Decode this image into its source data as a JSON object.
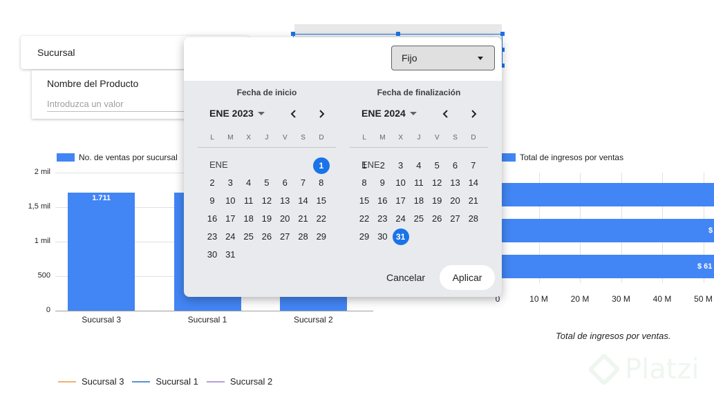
{
  "filters": {
    "sucursal_label": "Sucursal",
    "producto_label": "Nombre del Producto",
    "producto_placeholder": "Introduzca un valor"
  },
  "date_picker": {
    "mode_value": "Fijo",
    "start": {
      "title": "Fecha de inicio",
      "month_label": "ENE 2023",
      "month_tag": "ENE",
      "first_weekday_index": 6,
      "days_in_month": 31,
      "selected_day": 1
    },
    "end": {
      "title": "Fecha de finalización",
      "month_label": "ENE 2024",
      "month_tag": "ENE",
      "first_weekday_index": 0,
      "days_in_month": 31,
      "selected_day": 31
    },
    "weekdays": [
      "L",
      "M",
      "X",
      "J",
      "V",
      "S",
      "D"
    ],
    "cancel_label": "Cancelar",
    "apply_label": "Aplicar"
  },
  "chart_data": [
    {
      "type": "bar",
      "legend": "No. de ventas por sucursal",
      "categories": [
        "Sucursal 3",
        "Sucursal 1",
        "Sucursal 2"
      ],
      "values": [
        1711,
        1711,
        1711
      ],
      "data_labels": [
        "1.711"
      ],
      "y_ticks": [
        "2 mil",
        "1,5 mil",
        "1 mil",
        "500",
        "0"
      ],
      "ylim": [
        0,
        2000
      ],
      "color": "#4285f4"
    },
    {
      "type": "bar",
      "orientation": "horizontal",
      "legend": "Total de ingresos por ventas",
      "x_ticks": [
        "0",
        "10 M",
        "20 M",
        "30 M",
        "40 M",
        "50 M"
      ],
      "data_labels": [
        "$",
        "$ 61"
      ],
      "caption": "Total de ingresos por ventas.",
      "color": "#4285f4"
    },
    {
      "type": "line",
      "series": [
        {
          "name": "Sucursal 3",
          "color": "#f2b06e"
        },
        {
          "name": "Sucursal 1",
          "color": "#5b8fd6"
        },
        {
          "name": "Sucursal 2",
          "color": "#b39ddb"
        }
      ]
    }
  ],
  "watermark": "Platzi"
}
